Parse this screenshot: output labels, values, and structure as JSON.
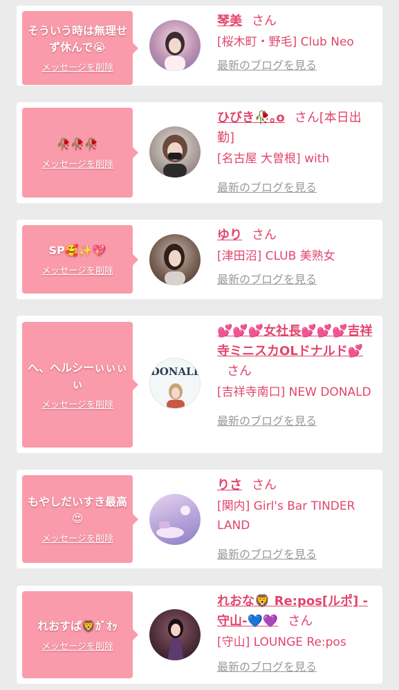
{
  "delete_label": "メッセージを削除",
  "san_label": "さん",
  "blog_label": "最新のブログを見る",
  "colors": {
    "accent": "#e1456d",
    "bubble": "#f99bab",
    "background": "#ebebeb"
  },
  "entries": [
    {
      "message": "そういう時は無理せず休んで😭",
      "name": "琴美",
      "suffix": "",
      "shop": "[桜木町・野毛] Club Neo"
    },
    {
      "message": "🥀🥀🥀",
      "name": "ひびき🥀｡o",
      "suffix": "[本日出勤]",
      "shop": "[名古屋 大曽根] with"
    },
    {
      "message": "SP🥰✨💖",
      "name": "ゆり",
      "suffix": "",
      "shop": "[津田沼] CLUB 美熟女"
    },
    {
      "message": "へ、ヘルシーぃぃぃぃ",
      "name": "💕💕💕女社長💕💕💕吉祥寺ミニスカOLドナルド💕",
      "suffix": "",
      "shop": "[吉祥寺南口] NEW DONALD",
      "avatar_text": "DONALL"
    },
    {
      "message": "もやしだいすき最高😍",
      "name": "りさ",
      "suffix": "",
      "shop": "[関内] Girl's Bar TINDER LAND"
    },
    {
      "message": "れおすぱ🦁ｶﾞｵｯ",
      "name": "れおな🦁 Re:pos[ルポ] -守山-💙💜",
      "suffix": "",
      "shop": "[守山] LOUNGE Re:pos"
    }
  ]
}
